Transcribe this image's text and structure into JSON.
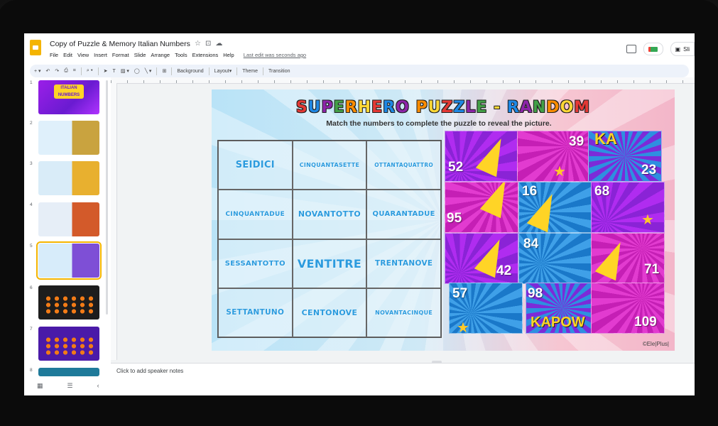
{
  "app": {
    "doc_title": "Copy of Puzzle & Memory Italian Numbers",
    "menu": [
      "File",
      "Edit",
      "View",
      "Insert",
      "Format",
      "Slide",
      "Arrange",
      "Tools",
      "Extensions",
      "Help"
    ],
    "last_edit": "Last edit was seconds ago",
    "slideshow_label": "Sli"
  },
  "toolbar": {
    "background_label": "Background",
    "layout_label": "Layout",
    "theme_label": "Theme",
    "transition_label": "Transition"
  },
  "filmstrip": {
    "slides": [
      {
        "number": "1",
        "selected": false
      },
      {
        "number": "2",
        "selected": false
      },
      {
        "number": "3",
        "selected": false
      },
      {
        "number": "4",
        "selected": false
      },
      {
        "number": "5",
        "selected": true
      },
      {
        "number": "6",
        "selected": false
      },
      {
        "number": "7",
        "selected": false
      },
      {
        "number": "8",
        "selected": false
      }
    ],
    "thumb1_text": "ITALIAN NUMBERS"
  },
  "slide": {
    "title": "SUPERHERO PUZZLE - RANDOM",
    "subtitle": "Match the numbers to complete the puzzle to reveal the picture.",
    "words": [
      "SEIDICI",
      "CINQUANTASETTE",
      "OTTANTAQUATTRO",
      "CINQUANTADUE",
      "NOVANTOTTO",
      "QUARANTADUE",
      "SESSANTOTTO",
      "VENTITRE",
      "TRENTANOVE",
      "SETTANTUNO",
      "CENTONOVE",
      "NOVANTACINQUE"
    ],
    "pieces": [
      "52",
      "39",
      "23",
      "95",
      "16",
      "68",
      "42",
      "84",
      "71",
      "57",
      "98",
      "109"
    ],
    "brand": "©Ele|Plus|",
    "comic_text_1": "KA",
    "comic_text_2": "KAPOW"
  },
  "notes": {
    "placeholder": "Click to add speaker notes"
  },
  "colors": {
    "accent_yellow": "#f4b400",
    "word_blue": "#2b9bde"
  }
}
